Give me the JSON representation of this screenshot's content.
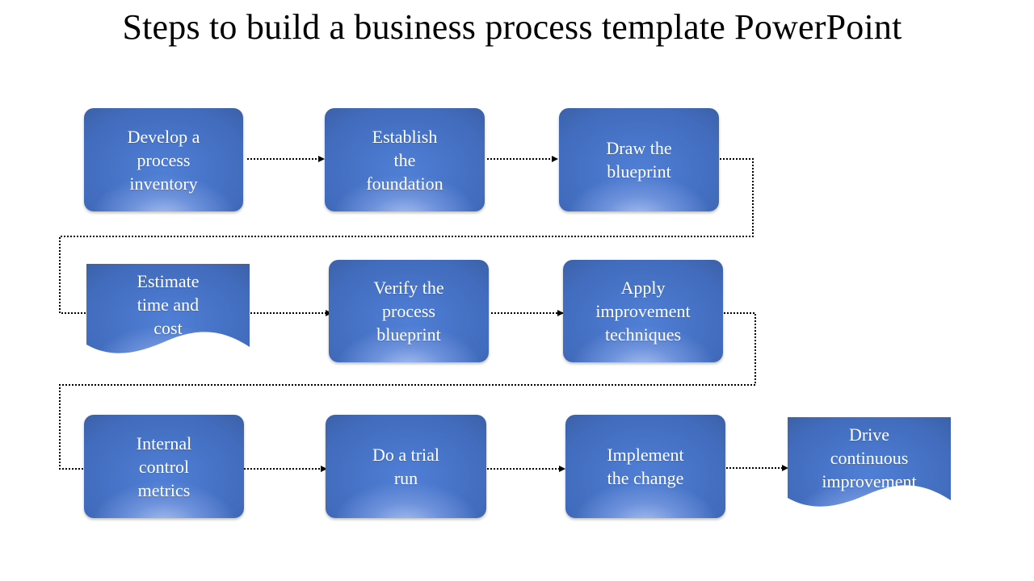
{
  "title": "Steps to build a business process template PowerPoint",
  "diagram": {
    "accent_color": "#4472c4",
    "connector_style": "dotted-arrow",
    "steps": [
      {
        "label": "Develop a process inventory",
        "shape": "rounded-rect"
      },
      {
        "label": "Establish the foundation",
        "shape": "rounded-rect"
      },
      {
        "label": "Draw the blueprint",
        "shape": "rounded-rect"
      },
      {
        "label": "Estimate time and cost",
        "shape": "document"
      },
      {
        "label": "Verify the process blueprint",
        "shape": "rounded-rect"
      },
      {
        "label": "Apply improvement techniques",
        "shape": "rounded-rect"
      },
      {
        "label": "Internal control metrics",
        "shape": "rounded-rect"
      },
      {
        "label": "Do a trial run",
        "shape": "rounded-rect"
      },
      {
        "label": "Implement the change",
        "shape": "rounded-rect"
      },
      {
        "label": "Drive continuous improvement",
        "shape": "document"
      }
    ],
    "lines": {
      "s0": [
        "Develop a",
        "process",
        "inventory"
      ],
      "s1": [
        "Establish",
        "the",
        "foundation"
      ],
      "s2": [
        "Draw the",
        "blueprint"
      ],
      "s3": [
        "Estimate",
        "time and",
        "cost"
      ],
      "s4": [
        "Verify the",
        "process",
        "blueprint"
      ],
      "s5": [
        "Apply",
        "improvement",
        "techniques"
      ],
      "s6": [
        "Internal",
        "control",
        "metrics"
      ],
      "s7": [
        "Do a trial",
        "run"
      ],
      "s8": [
        "Implement",
        "the change"
      ],
      "s9": [
        "Drive",
        "continuous",
        "improvement"
      ]
    }
  }
}
